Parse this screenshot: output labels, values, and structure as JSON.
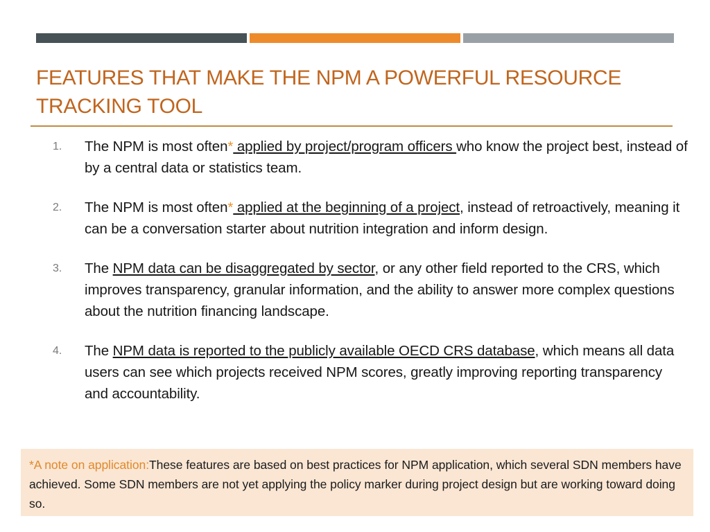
{
  "slide": {
    "title": "FEATURES THAT MAKE THE NPM A POWERFUL RESOURCE TRACKING TOOL",
    "accent_color": "#C0651E",
    "rule_color": "#C08B3E",
    "bars": [
      {
        "name": "dark",
        "color": "#465256"
      },
      {
        "name": "orange",
        "color": "#ED8B2B"
      },
      {
        "name": "gray",
        "color": "#9AA1A6"
      }
    ]
  },
  "body": {
    "items": [
      {
        "number": "1.",
        "pre": "The NPM is most often",
        "asterisk": "*",
        "underlined": " applied by project/program officers ",
        "post": "who know the project best, instead of by a central data or statistics team."
      },
      {
        "number": "2.",
        "pre": "The NPM is most often",
        "asterisk": "*",
        "underlined": " applied at the beginning of a project",
        "post": ", instead of retroactively, meaning it can be a conversation starter about nutrition integration and inform design."
      },
      {
        "number": "3.",
        "pre": "The ",
        "asterisk": "",
        "underlined": "NPM data can be disaggregated by sector",
        "post": ", or any other field reported to the CRS, which improves transparency, granular information, and the ability to answer more complex questions about the nutrition financing landscape."
      },
      {
        "number": "4.",
        "pre": "The ",
        "asterisk": "",
        "underlined": "NPM data is reported to the publicly available OECD CRS database",
        "post": ", which means all data users can see which projects received NPM scores, greatly improving reporting transparency and accountability."
      }
    ]
  },
  "note": {
    "background_color": "#FAE6D3",
    "lead_color": "#E0892C",
    "lead": "*A note on application:",
    "text": "These features are based on best practices for NPM application, which several SDN members have achieved. Some SDN members are not yet applying the policy marker during project design but are working toward doing so."
  }
}
